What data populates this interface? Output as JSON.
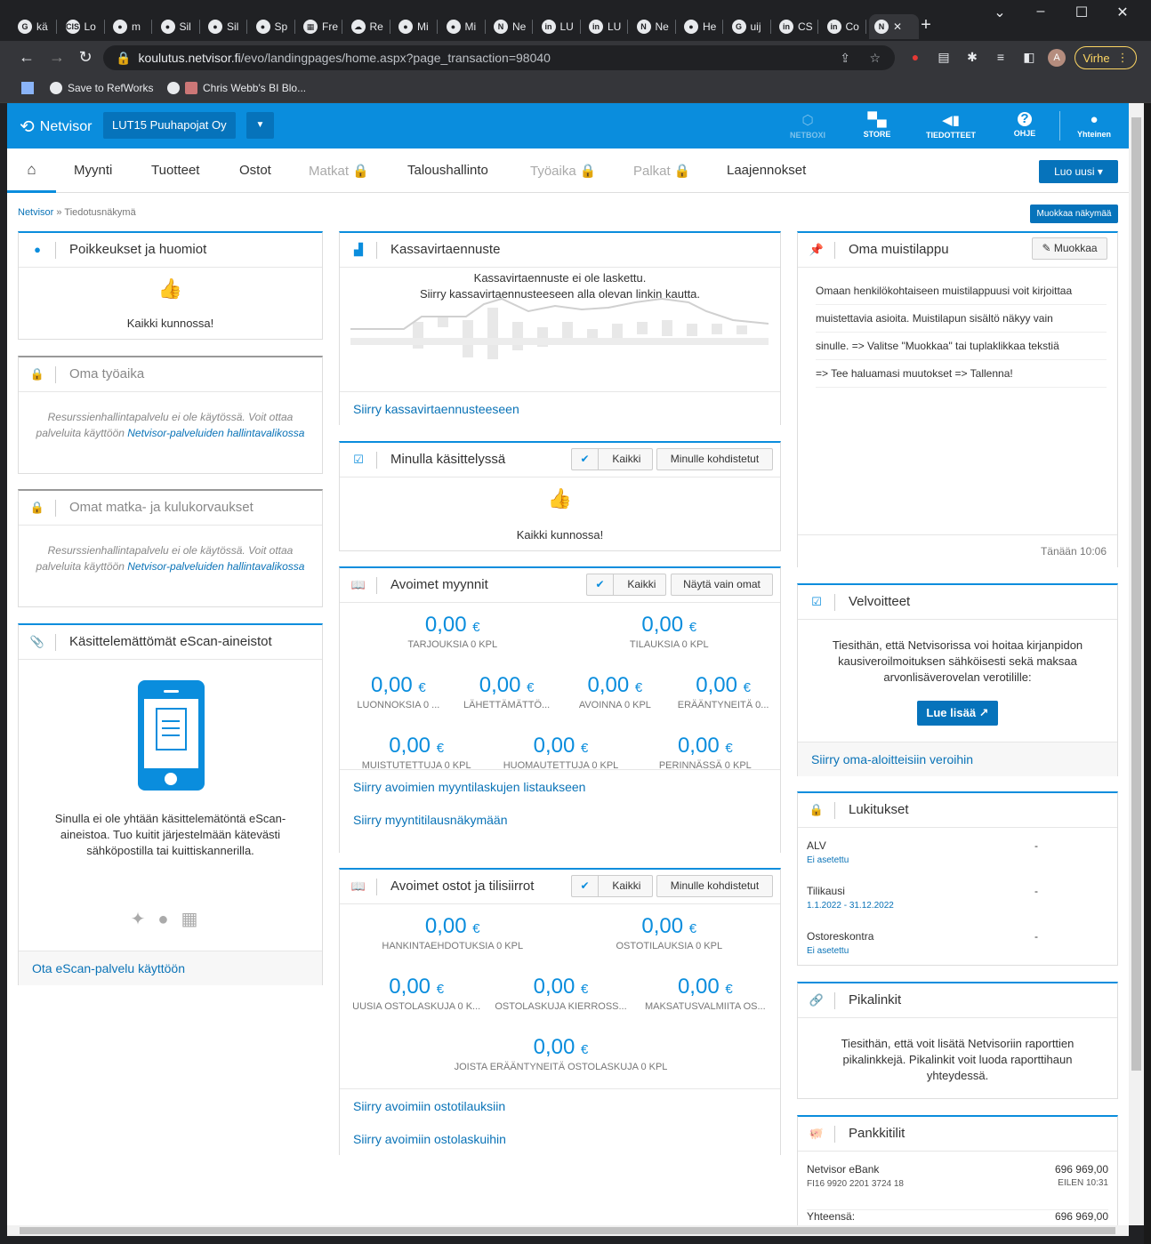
{
  "browser": {
    "tabs": [
      {
        "icon": "G",
        "label": "kä"
      },
      {
        "icon": "CIS",
        "label": "Lo"
      },
      {
        "icon": "●",
        "label": "m"
      },
      {
        "icon": "●",
        "label": "Sil"
      },
      {
        "icon": "●",
        "label": "Sil"
      },
      {
        "icon": "●",
        "label": "Sp"
      },
      {
        "icon": "▦",
        "label": "Fre"
      },
      {
        "icon": "☁",
        "label": "Re"
      },
      {
        "icon": "●",
        "label": "Mi"
      },
      {
        "icon": "●",
        "label": "Mi"
      },
      {
        "icon": "N",
        "label": "Ne"
      },
      {
        "icon": "in",
        "label": "LU"
      },
      {
        "icon": "in",
        "label": "LU"
      },
      {
        "icon": "N",
        "label": "Ne"
      },
      {
        "icon": "●",
        "label": "He"
      },
      {
        "icon": "G",
        "label": "uij"
      },
      {
        "icon": "in",
        "label": "CS"
      },
      {
        "icon": "in",
        "label": "Co"
      },
      {
        "icon": "N",
        "label": "",
        "close": "✕"
      }
    ],
    "url_host": "koulutus.netvisor.fi",
    "url_path": "/evo/landingpages/home.aspx?page_transaction=98040",
    "profile_letter": "A",
    "virhe_label": "Virhe",
    "bookmarks": [
      "Save to RefWorks",
      "Chris Webb's BI Blo..."
    ]
  },
  "topbar": {
    "logo_text": "Netvisor",
    "company": "LUT15 Puuhapojat Oy",
    "items": [
      {
        "label": "NETBOXI",
        "icon": "⬡"
      },
      {
        "label": "STORE",
        "icon": "🛒"
      },
      {
        "label": "TIEDOTTEET",
        "icon": "📢"
      },
      {
        "label": "OHJE",
        "icon": "?"
      },
      {
        "label": "Yhteinen",
        "icon": "👤"
      }
    ]
  },
  "menu": {
    "items": [
      "Myynti",
      "Tuotteet",
      "Ostot",
      "Matkat",
      "Taloushallinto",
      "Työaika",
      "Palkat",
      "Laajennokset"
    ],
    "new_button": "Luo uusi"
  },
  "breadcrumb": {
    "root": "Netvisor",
    "sep": "»",
    "current": "Tiedotusnäkymä"
  },
  "edit_view_button": "Muokkaa näkymää",
  "col1": {
    "poikkeukset": {
      "title": "Poikkeukset ja huomiot",
      "text": "Kaikki kunnossa!"
    },
    "tyoaika": {
      "title": "Oma työaika",
      "text": "Resurssienhallintapalvelu ei ole käytössä. Voit ottaa palveluita käyttöön ",
      "link": "Netvisor-palveluiden hallintavalikossa"
    },
    "matka": {
      "title": "Omat matka- ja kulukorvaukset",
      "text": "Resurssienhallintapalvelu ei ole käytössä. Voit ottaa palveluita käyttöön ",
      "link": "Netvisor-palveluiden hallintavalikossa"
    },
    "escan": {
      "title": "Käsittelemättömät eScan-aineistot",
      "text": "Sinulla ei ole yhtään käsittelemätöntä eScan-aineistoa. Tuo kuitit järjestelmään kätevästi sähköpostilla tai kuittiskannerilla.",
      "link": "Ota eScan-palvelu käyttöön"
    }
  },
  "col2": {
    "kassa": {
      "title": "Kassavirtaennuste",
      "line1": "Kassavirtaennuste ei ole laskettu.",
      "line2": "Siirry kassavirtaennusteeseen alla olevan linkin kautta.",
      "link": "Siirry kassavirtaennusteeseen"
    },
    "kasittelyssa": {
      "title": "Minulla käsittelyssä",
      "btn_all": "Kaikki",
      "btn_mine": "Minulle kohdistetut",
      "text": "Kaikki kunnossa!"
    },
    "myynnit": {
      "title": "Avoimet myynnit",
      "btn_all": "Kaikki",
      "btn_mine": "Näytä vain omat",
      "row1": [
        {
          "v": "0,00",
          "l": "TARJOUKSIA 0 KPL"
        },
        {
          "v": "0,00",
          "l": "TILAUKSIA 0 KPL"
        }
      ],
      "row2": [
        {
          "v": "0,00",
          "l": "LUONNOKSIA 0 ..."
        },
        {
          "v": "0,00",
          "l": "LÄHETTÄMÄTTÖ..."
        },
        {
          "v": "0,00",
          "l": "AVOINNA 0 KPL"
        },
        {
          "v": "0,00",
          "l": "ERÄÄNTYNEITÄ 0..."
        }
      ],
      "row3": [
        {
          "v": "0,00",
          "l": "MUISTUTETTUJA 0 KPL"
        },
        {
          "v": "0,00",
          "l": "HUOMAUTETTUJA 0 KPL"
        },
        {
          "v": "0,00",
          "l": "PERINNÄSSÄ 0 KPL"
        }
      ],
      "currency": "€",
      "link1": "Siirry avoimien myyntilaskujen listaukseen",
      "link2": "Siirry myyntitilausnäkymään"
    },
    "ostot": {
      "title": "Avoimet ostot ja tilisiirrot",
      "btn_all": "Kaikki",
      "btn_mine": "Minulle kohdistetut",
      "row1": [
        {
          "v": "0,00",
          "l": "HANKINTAEHDOTUKSIA 0 KPL"
        },
        {
          "v": "0,00",
          "l": "OSTOTILAUKSIA 0 KPL"
        }
      ],
      "row2": [
        {
          "v": "0,00",
          "l": "UUSIA OSTOLASKUJA 0 K..."
        },
        {
          "v": "0,00",
          "l": "OSTOLASKUJA KIERROSS..."
        },
        {
          "v": "0,00",
          "l": "MAKSATUSVALMIITA OS..."
        }
      ],
      "row3": [
        {
          "v": "0,00",
          "l": "JOISTA ERÄÄNTYNEITÄ OSTOLASKUJA 0 KPL"
        }
      ],
      "link1": "Siirry avoimiin ostotilauksiin",
      "link2": "Siirry avoimiin ostolaskuihin"
    }
  },
  "col3": {
    "muistilappu": {
      "title": "Oma muistilappu",
      "edit": "Muokkaa",
      "lines": [
        "Omaan henkilökohtaiseen muistilappuusi voit kirjoittaa",
        "muistettavia asioita. Muistilapun sisältö näkyy vain",
        "sinulle.  => Valitse \"Muokkaa\" tai tuplaklikkaa tekstiä",
        "=> Tee haluamasi muutokset  => Tallenna!"
      ],
      "time": "Tänään 10:06"
    },
    "velvoitteet": {
      "title": "Velvoitteet",
      "text": "Tiesithän, että Netvisorissa voi hoitaa kirjanpidon kausiveroilmoituksen sähköisesti sekä maksaa arvonlisäverovelan verotilille:",
      "btn": "Lue lisää ↗",
      "link": "Siirry oma-aloitteisiin veroihin"
    },
    "lukitukset": {
      "title": "Lukitukset",
      "rows": [
        {
          "k": "ALV",
          "s": "Ei asetettu",
          "v": "-"
        },
        {
          "k": "Tilikausi",
          "s": "1.1.2022 - 31.12.2022",
          "v": "-"
        },
        {
          "k": "Ostoreskontra",
          "s": "Ei asetettu",
          "v": "-"
        }
      ]
    },
    "pikalinkit": {
      "title": "Pikalinkit",
      "text": "Tiesithän, että voit lisätä Netvisoriin raporttien pikalinkkejä. Pikalinkit voit luoda raporttihaun yhteydessä."
    },
    "pankkitilit": {
      "title": "Pankkitilit",
      "name": "Netvisor eBank",
      "iban": "FI16 9920 2201 3724 18",
      "amount": "696 969,00",
      "time": "EILEN 10:31",
      "total_label": "Yhteensä:",
      "total": "696 969,00"
    }
  }
}
